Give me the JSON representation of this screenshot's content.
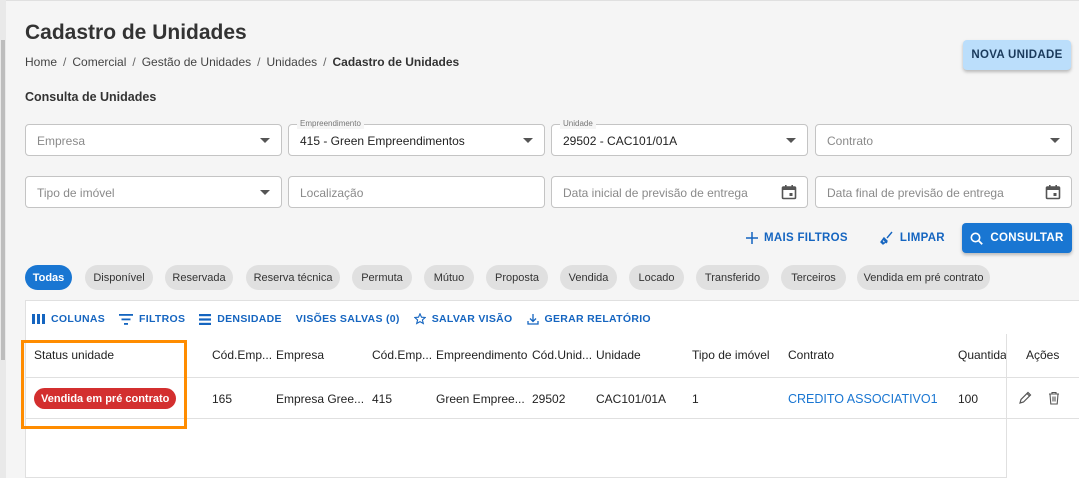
{
  "page": {
    "title": "Cadastro de Unidades",
    "breadcrumb": [
      "Home",
      "Comercial",
      "Gestão de Unidades",
      "Unidades",
      "Cadastro de Unidades"
    ],
    "breadcrumb_sep": "/",
    "new_button": "NOVA UNIDADE",
    "section_title": "Consulta de Unidades"
  },
  "filters": {
    "empresa": {
      "placeholder": "Empresa"
    },
    "empreendimento": {
      "label": "Empreendimento",
      "value": "415 - Green Empreendimentos"
    },
    "unidade": {
      "label": "Unidade",
      "value": "29502 - CAC101/01A"
    },
    "contrato": {
      "placeholder": "Contrato"
    },
    "tipo_imovel": {
      "placeholder": "Tipo de imóvel"
    },
    "localizacao": {
      "placeholder": "Localização"
    },
    "data_inicial": {
      "placeholder": "Data inicial de previsão de entrega"
    },
    "data_final": {
      "placeholder": "Data final de previsão de entrega"
    }
  },
  "actions": {
    "mais_filtros": "MAIS FILTROS",
    "limpar": "LIMPAR",
    "consultar": "CONSULTAR"
  },
  "status_chips": [
    "Todas",
    "Disponível",
    "Reservada",
    "Reserva técnica",
    "Permuta",
    "Mútuo",
    "Proposta",
    "Vendida",
    "Locado",
    "Transferido",
    "Terceiros",
    "Vendida em pré contrato"
  ],
  "active_chip": "Todas",
  "toolbar": {
    "colunas": "COLUNAS",
    "filtros": "FILTROS",
    "densidade": "DENSIDADE",
    "visoes_salvas": "VISÕES SALVAS (0)",
    "salvar_visao": "SALVAR VISÃO",
    "gerar_relatorio": "GERAR RELATÓRIO"
  },
  "table": {
    "columns": [
      "Status unidade",
      "Cód.Emp...",
      "Empresa",
      "Cód.Emp...",
      "Empreendimento",
      "Cód.Unid...",
      "Unidade",
      "Tipo de imóvel",
      "Contrato",
      "Quantidad",
      "Ações"
    ],
    "rows": [
      {
        "status": "Vendida em pré contrato",
        "cod_empresa": "165",
        "empresa": "Empresa Gree...",
        "cod_empreendimento": "415",
        "empreendimento": "Green Empree...",
        "cod_unidade": "29502",
        "unidade": "CAC101/01A",
        "tipo_imovel": "1",
        "contrato": "CREDITO ASSOCIATIVO1",
        "quantidade": "100"
      }
    ]
  },
  "colors": {
    "primary": "#1976d2",
    "badge_red": "#d32f2f",
    "highlight": "#ff8c00",
    "new_button_bg": "#bbdefb"
  }
}
